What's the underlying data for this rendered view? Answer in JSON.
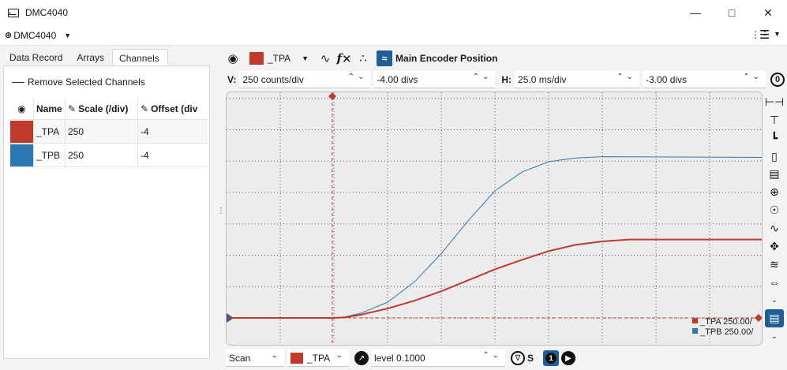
{
  "window": {
    "title": "DMC4040"
  },
  "controller": {
    "label": "DMC4040"
  },
  "left_tabs": [
    {
      "label": "Data Record"
    },
    {
      "label": "Arrays"
    },
    {
      "label": "Channels"
    }
  ],
  "channels_panel": {
    "remove_label": "Remove Selected Channels",
    "columns": [
      "Name",
      "Scale (/div)",
      "Offset (div"
    ],
    "rows": [
      {
        "name": "_TPA",
        "scale": "250",
        "offset": "-4",
        "color": "#c0392b"
      },
      {
        "name": "_TPB",
        "scale": "250",
        "offset": "-4",
        "color": "#2e77b5"
      }
    ]
  },
  "scope_toolbar": {
    "channel": "_TPA",
    "channel_color": "#c0392b",
    "main_label": "Main Encoder Position"
  },
  "scale_bar": {
    "v_label": "V:",
    "v_scale": "250 counts/div",
    "v_offset": "-4.00 divs",
    "h_label": "H:",
    "h_scale": "25.0 ms/div",
    "h_offset": "-3.00 divs",
    "zero_label": "0"
  },
  "bottom_bar": {
    "mode": "Scan",
    "trigger_channel": "_TPA",
    "trigger_color": "#c0392b",
    "level": "level 0.1000",
    "slope_label": "S",
    "run_index": "1"
  },
  "chart_data": {
    "type": "line",
    "grid": true,
    "divisions": {
      "x": 10,
      "y": 8
    },
    "trigger_marker_div": 2,
    "legend": [
      "_TPA 250.00/",
      "_TPB 250.00/"
    ],
    "series": [
      {
        "name": "_TPA",
        "color": "#c0392b",
        "points_div": [
          [
            0,
            0
          ],
          [
            2,
            0
          ],
          [
            2.2,
            0.02
          ],
          [
            2.5,
            0.1
          ],
          [
            3,
            0.3
          ],
          [
            3.5,
            0.55
          ],
          [
            4,
            0.85
          ],
          [
            4.5,
            1.2
          ],
          [
            5,
            1.55
          ],
          [
            5.5,
            1.85
          ],
          [
            6,
            2.13
          ],
          [
            6.5,
            2.33
          ],
          [
            7,
            2.44
          ],
          [
            7.5,
            2.5
          ],
          [
            10,
            2.5
          ]
        ]
      },
      {
        "name": "_TPB",
        "color": "#2e77b5",
        "points_div": [
          [
            0,
            0
          ],
          [
            2,
            0
          ],
          [
            2.2,
            0.03
          ],
          [
            2.5,
            0.15
          ],
          [
            3,
            0.5
          ],
          [
            3.5,
            1.15
          ],
          [
            4,
            2.05
          ],
          [
            4.5,
            3.1
          ],
          [
            5,
            4.05
          ],
          [
            5.5,
            4.65
          ],
          [
            6,
            4.98
          ],
          [
            6.5,
            5.1
          ],
          [
            7,
            5.14
          ],
          [
            10,
            5.12
          ]
        ]
      }
    ]
  }
}
